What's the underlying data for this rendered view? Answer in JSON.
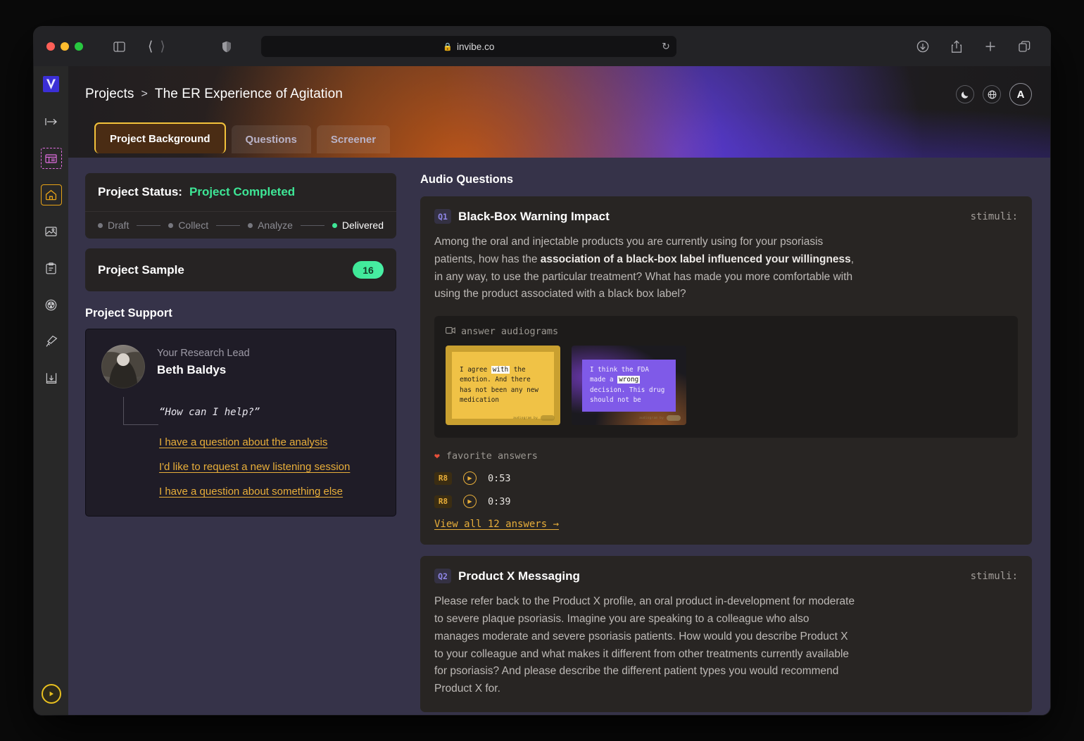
{
  "browser": {
    "url": "invibe.co",
    "lock_icon": "lock-icon",
    "reload_icon": "reload-icon",
    "sidebar_toggle_icon": "sidebar-toggle-icon",
    "back_icon": "chevron-left-icon",
    "forward_icon": "chevron-right-icon",
    "shield_icon": "shield-icon",
    "right_icons": [
      "download-icon",
      "share-icon",
      "new-tab-icon",
      "tab-overview-icon"
    ]
  },
  "rail": {
    "logo": "invibe-logo",
    "items": [
      {
        "icon": "collapse-arrow-icon",
        "name": "collapse-sidebar"
      },
      {
        "icon": "grid-building-icon",
        "name": "workspace"
      },
      {
        "icon": "home-icon",
        "name": "home"
      },
      {
        "icon": "image-icon",
        "name": "media"
      },
      {
        "icon": "clipboard-icon",
        "name": "reports"
      },
      {
        "icon": "film-reel-icon",
        "name": "recordings"
      },
      {
        "icon": "telescope-icon",
        "name": "explore"
      },
      {
        "icon": "inbox-download-icon",
        "name": "downloads"
      }
    ],
    "play_button": "play-icon"
  },
  "header": {
    "breadcrumb_root": "Projects",
    "breadcrumb_sep": ">",
    "breadcrumb_current": "The ER Experience of Agitation",
    "theme_icon": "moon-icon",
    "language_icon": "globe-icon",
    "avatar_initial": "A"
  },
  "tabs": [
    {
      "label": "Project Background",
      "active": true
    },
    {
      "label": "Questions",
      "active": false
    },
    {
      "label": "Screener",
      "active": false
    }
  ],
  "project_status": {
    "label": "Project Status:",
    "value": "Project Completed",
    "steps": [
      {
        "label": "Draft",
        "done": false
      },
      {
        "label": "Collect",
        "done": false
      },
      {
        "label": "Analyze",
        "done": false
      },
      {
        "label": "Delivered",
        "done": true
      }
    ]
  },
  "project_sample": {
    "label": "Project Sample",
    "count": "16"
  },
  "project_support": {
    "title": "Project Support",
    "role": "Your Research Lead",
    "name": "Beth Baldys",
    "quote": "“How can I help?”",
    "links": [
      "I have a question about the analysis",
      "I'd like to request a new listening session",
      "I have a question about something else"
    ]
  },
  "questions_section": {
    "title": "Audio Questions",
    "stimuli_label": "stimuli:",
    "audiograms_label": "answer audiograms",
    "audiograms_icon": "video-icon",
    "favorites_label": "favorite answers",
    "favorites_icon": "heart-icon",
    "questions": [
      {
        "badge": "Q1",
        "title": "Black-Box Warning Impact",
        "body_part1": "Among the oral and injectable products you are currently using for your psoriasis patients, how has the ",
        "body_bold": "association of a black-box label influenced your willingness",
        "body_part2": ", in any way, to use the particular treatment? What has made you more comfortable with using the product associated with a black box label?",
        "audiograms": [
          {
            "theme": "gold",
            "text_before": "I agree ",
            "text_highlight": "with",
            "text_after": " the emotion. And there has not been any new medication",
            "watermark": "audiogram by",
            "brand": "invibe"
          },
          {
            "theme": "purple",
            "text_before": "I think the FDA made a ",
            "text_highlight": "wrong",
            "text_after": " decision. This drug should not be",
            "watermark": "audiogram by",
            "brand": "invibe"
          }
        ],
        "favorites": [
          {
            "respondent": "R8",
            "duration": "0:53",
            "play_icon": "play-icon"
          },
          {
            "respondent": "R8",
            "duration": "0:39",
            "play_icon": "play-icon"
          }
        ],
        "view_all": "View all 12 answers →"
      },
      {
        "badge": "Q2",
        "title": "Product X Messaging",
        "body_part1": "Please refer back to the Product X profile, an oral product in-development for moderate to severe plaque psoriasis. Imagine you are speaking to a colleague who also manages moderate and severe psoriasis patients. How would you describe Product X to your colleague and what makes it different from other treatments currently available for psoriasis? And please describe the different patient types you would recommend Product X for.",
        "body_bold": "",
        "body_part2": ""
      }
    ]
  }
}
